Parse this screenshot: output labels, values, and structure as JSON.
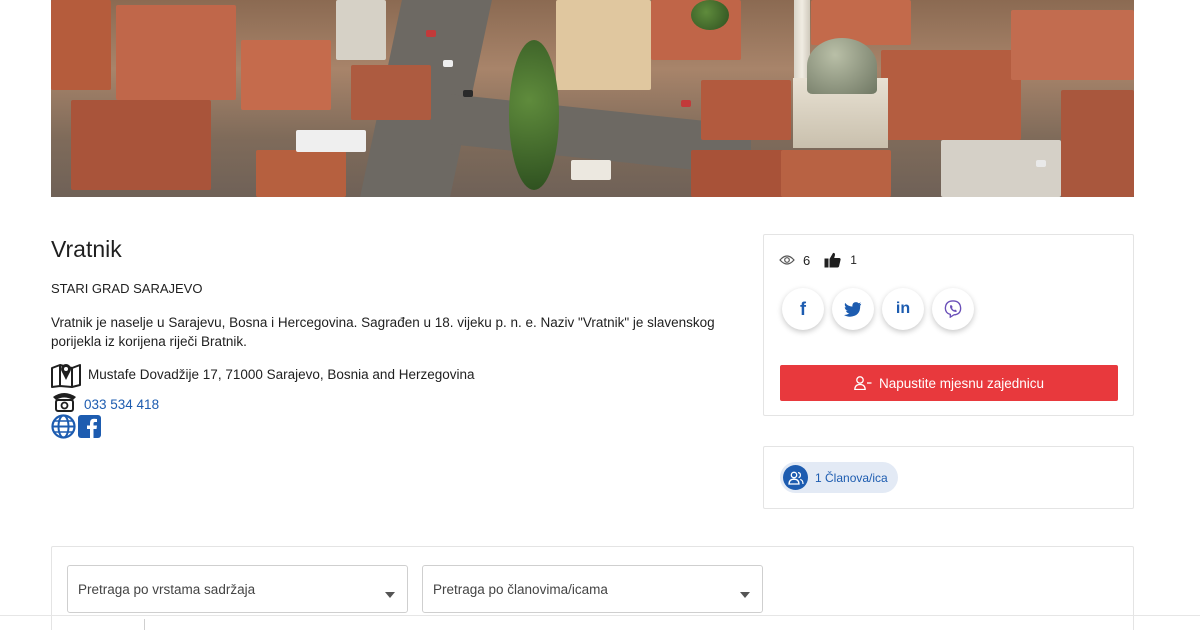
{
  "place": {
    "title": "Vratnik",
    "municipality": "STARI GRAD SARAJEVO",
    "description": "Vratnik je naselje u Sarajevu, Bosna i Hercegovina. Sagrađen u 18. vijeku p. n. e. Naziv \"Vratnik\" je slavenskog porijekla iz korijena riječi Bratnik.",
    "address": "Mustafe Dovadžije 17, 71000 Sarajevo, Bosnia and Herzegovina",
    "phone": "033 534 418"
  },
  "stats": {
    "views": "6",
    "likes": "1"
  },
  "share": {
    "facebook_glyph": "f",
    "twitter_icon": "twitter-icon",
    "linkedin_glyph": "in",
    "viber_icon": "viber-icon"
  },
  "actions": {
    "leave_label": "Napustite mjesnu zajednicu"
  },
  "members": {
    "label": "1 Članova/ica"
  },
  "filters": {
    "content_type_placeholder": "Pretraga po vrstama sadržaja",
    "members_placeholder": "Pretraga po članovima/icama"
  },
  "colors": {
    "accent_blue": "#1d5cb0",
    "danger_red": "#e8393d",
    "chip_bg": "#e3eaf5"
  }
}
